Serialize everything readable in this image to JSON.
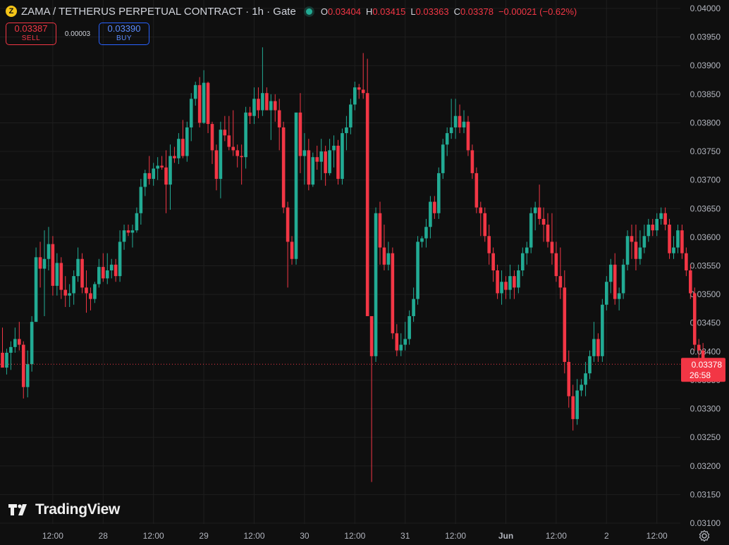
{
  "header": {
    "coin_glyph": "Z",
    "title": "ZAMA / TETHERUS PERPETUAL CONTRACT · 1h · Gate",
    "ohlc": {
      "o_label": "O",
      "o": "0.03404",
      "h_label": "H",
      "h": "0.03415",
      "l_label": "L",
      "l": "0.03363",
      "c_label": "C",
      "c": "0.03378",
      "change": "−0.00021 (−0.62%)"
    }
  },
  "trade": {
    "sell_price": "0.03387",
    "sell_label": "SELL",
    "spread": "0.00003",
    "buy_price": "0.03390",
    "buy_label": "BUY"
  },
  "price_tag": {
    "price": "0.03378",
    "countdown": "26:58"
  },
  "branding": {
    "logo_text": "TradingView"
  },
  "colors": {
    "background": "#0f0f0f",
    "grid": "#1e1e1e",
    "up": "#22ab94",
    "down": "#f23645",
    "axis_text": "#b2b5be",
    "buy_accent": "#2962ff"
  },
  "chart_data": {
    "type": "candlestick",
    "interval": "1h",
    "ylim": [
      0.031,
      0.04
    ],
    "y_ticks": [
      "0.03100",
      "0.03150",
      "0.03200",
      "0.03250",
      "0.03300",
      "0.03350",
      "0.03400",
      "0.03450",
      "0.03500",
      "0.03550",
      "0.03600",
      "0.03650",
      "0.03700",
      "0.03750",
      "0.03800",
      "0.03850",
      "0.03900",
      "0.03950",
      "0.04000"
    ],
    "x_ticks": [
      {
        "label": "12:00",
        "index": 12
      },
      {
        "label": "28",
        "index": 24
      },
      {
        "label": "12:00",
        "index": 36
      },
      {
        "label": "29",
        "index": 48
      },
      {
        "label": "12:00",
        "index": 60
      },
      {
        "label": "30",
        "index": 72
      },
      {
        "label": "12:00",
        "index": 84
      },
      {
        "label": "31",
        "index": 96
      },
      {
        "label": "12:00",
        "index": 108
      },
      {
        "label": "Jun",
        "index": 120
      },
      {
        "label": "12:00",
        "index": 132
      },
      {
        "label": "2",
        "index": 144
      },
      {
        "label": "12:00",
        "index": 156
      }
    ],
    "current_price": 0.03378,
    "candles": [
      [
        0.03398,
        0.03442,
        0.03378,
        0.03372
      ],
      [
        0.03372,
        0.03405,
        0.0336,
        0.03398
      ],
      [
        0.03398,
        0.03418,
        0.03368,
        0.03408
      ],
      [
        0.03408,
        0.03442,
        0.03398,
        0.03422
      ],
      [
        0.03422,
        0.03452,
        0.03402,
        0.03412
      ],
      [
        0.03412,
        0.03418,
        0.03318,
        0.03338
      ],
      [
        0.03338,
        0.03402,
        0.0332,
        0.03378
      ],
      [
        0.03378,
        0.03462,
        0.03365,
        0.03452
      ],
      [
        0.03452,
        0.03582,
        0.03452,
        0.03565
      ],
      [
        0.03565,
        0.03592,
        0.03512,
        0.03545
      ],
      [
        0.03545,
        0.03612,
        0.03462,
        0.03562
      ],
      [
        0.03562,
        0.03618,
        0.03542,
        0.03588
      ],
      [
        0.03588,
        0.03602,
        0.03498,
        0.03515
      ],
      [
        0.03515,
        0.03572,
        0.03498,
        0.03555
      ],
      [
        0.03555,
        0.03565,
        0.03492,
        0.03508
      ],
      [
        0.03508,
        0.03532,
        0.03478,
        0.03498
      ],
      [
        0.03498,
        0.03518,
        0.03478,
        0.03502
      ],
      [
        0.03502,
        0.03542,
        0.03482,
        0.03532
      ],
      [
        0.03532,
        0.03582,
        0.03522,
        0.03562
      ],
      [
        0.03562,
        0.03572,
        0.03502,
        0.03512
      ],
      [
        0.03512,
        0.03542,
        0.03468,
        0.03502
      ],
      [
        0.03502,
        0.03512,
        0.03472,
        0.03492
      ],
      [
        0.03492,
        0.03522,
        0.03485,
        0.03518
      ],
      [
        0.03518,
        0.03562,
        0.03512,
        0.03548
      ],
      [
        0.03548,
        0.03572,
        0.03522,
        0.03528
      ],
      [
        0.03528,
        0.03572,
        0.03518,
        0.03542
      ],
      [
        0.03542,
        0.03562,
        0.03528,
        0.03552
      ],
      [
        0.03552,
        0.03562,
        0.03522,
        0.03532
      ],
      [
        0.03532,
        0.03612,
        0.03522,
        0.03592
      ],
      [
        0.03592,
        0.03622,
        0.03578,
        0.03612
      ],
      [
        0.03612,
        0.03622,
        0.03602,
        0.03608
      ],
      [
        0.03608,
        0.03622,
        0.03582,
        0.03612
      ],
      [
        0.03612,
        0.03652,
        0.03608,
        0.03642
      ],
      [
        0.03642,
        0.03702,
        0.03622,
        0.03688
      ],
      [
        0.03688,
        0.03718,
        0.03672,
        0.03712
      ],
      [
        0.03712,
        0.03742,
        0.03692,
        0.03702
      ],
      [
        0.03702,
        0.0373,
        0.0369,
        0.0372
      ],
      [
        0.0372,
        0.0374,
        0.037,
        0.03725
      ],
      [
        0.03725,
        0.03742,
        0.03718,
        0.03722
      ],
      [
        0.03722,
        0.03752,
        0.03642,
        0.03692
      ],
      [
        0.03692,
        0.03762,
        0.03648,
        0.03742
      ],
      [
        0.03742,
        0.03758,
        0.0373,
        0.03738
      ],
      [
        0.03738,
        0.03782,
        0.03728,
        0.03772
      ],
      [
        0.03772,
        0.03805,
        0.03738,
        0.03742
      ],
      [
        0.03742,
        0.03802,
        0.03732,
        0.03792
      ],
      [
        0.03792,
        0.03852,
        0.03768,
        0.03842
      ],
      [
        0.03842,
        0.03872,
        0.0383,
        0.03866
      ],
      [
        0.03866,
        0.0388,
        0.03792,
        0.038
      ],
      [
        0.038,
        0.03892,
        0.03798,
        0.0387
      ],
      [
        0.0387,
        0.03872,
        0.03782,
        0.03798
      ],
      [
        0.03798,
        0.03802,
        0.03728,
        0.03752
      ],
      [
        0.03752,
        0.03762,
        0.03682,
        0.03702
      ],
      [
        0.03702,
        0.03802,
        0.03668,
        0.03788
      ],
      [
        0.03788,
        0.03812,
        0.03768,
        0.03778
      ],
      [
        0.03778,
        0.03812,
        0.03752,
        0.03758
      ],
      [
        0.03758,
        0.03822,
        0.03742,
        0.03752
      ],
      [
        0.03752,
        0.03762,
        0.03722,
        0.03742
      ],
      [
        0.03742,
        0.03762,
        0.03692,
        0.0374
      ],
      [
        0.0374,
        0.03828,
        0.0372,
        0.03818
      ],
      [
        0.03818,
        0.03828,
        0.03798,
        0.03812
      ],
      [
        0.03812,
        0.03862,
        0.03798,
        0.03842
      ],
      [
        0.03842,
        0.03862,
        0.03808,
        0.03822
      ],
      [
        0.03822,
        0.03932,
        0.03812,
        0.03852
      ],
      [
        0.03852,
        0.03862,
        0.03832,
        0.03822
      ],
      [
        0.03822,
        0.0385,
        0.0377,
        0.03838
      ],
      [
        0.03838,
        0.0385,
        0.03802,
        0.03822
      ],
      [
        0.03822,
        0.03842,
        0.03752,
        0.03792
      ],
      [
        0.03792,
        0.03802,
        0.03642,
        0.03652
      ],
      [
        0.03652,
        0.03662,
        0.03512,
        0.03592
      ],
      [
        0.03592,
        0.03602,
        0.03552,
        0.03562
      ],
      [
        0.03562,
        0.03812,
        0.03552,
        0.03818
      ],
      [
        0.03818,
        0.03852,
        0.03712,
        0.03742
      ],
      [
        0.03742,
        0.03782,
        0.03692,
        0.03752
      ],
      [
        0.03752,
        0.03772,
        0.03682,
        0.03692
      ],
      [
        0.03692,
        0.03748,
        0.03688,
        0.0374
      ],
      [
        0.0374,
        0.0376,
        0.03718,
        0.03732
      ],
      [
        0.03732,
        0.03772,
        0.037,
        0.0375
      ],
      [
        0.0375,
        0.0376,
        0.0369,
        0.03712
      ],
      [
        0.03712,
        0.03772,
        0.03708,
        0.03752
      ],
      [
        0.03752,
        0.03778,
        0.03722,
        0.0376
      ],
      [
        0.0376,
        0.0377,
        0.03692,
        0.03702
      ],
      [
        0.03702,
        0.0379,
        0.03692,
        0.03782
      ],
      [
        0.03782,
        0.03812,
        0.03752,
        0.03792
      ],
      [
        0.03792,
        0.03842,
        0.0378,
        0.03832
      ],
      [
        0.03832,
        0.03872,
        0.03822,
        0.03862
      ],
      [
        0.03862,
        0.03868,
        0.03842,
        0.03858
      ],
      [
        0.03858,
        0.03922,
        0.03842,
        0.03852
      ],
      [
        0.03852,
        0.03912,
        0.03542,
        0.03462
      ],
      [
        0.03462,
        0.03462,
        0.03172,
        0.03392
      ],
      [
        0.03392,
        0.03652,
        0.03382,
        0.03642
      ],
      [
        0.03642,
        0.03662,
        0.03552,
        0.03582
      ],
      [
        0.03582,
        0.03622,
        0.03542,
        0.03552
      ],
      [
        0.03552,
        0.03592,
        0.03542,
        0.03572
      ],
      [
        0.03572,
        0.03582,
        0.03422,
        0.03432
      ],
      [
        0.03432,
        0.03448,
        0.03392,
        0.03402
      ],
      [
        0.03402,
        0.03432,
        0.03392,
        0.03412
      ],
      [
        0.03412,
        0.03452,
        0.03402,
        0.03422
      ],
      [
        0.03422,
        0.03472,
        0.03412,
        0.03462
      ],
      [
        0.03462,
        0.03512,
        0.03452,
        0.03492
      ],
      [
        0.03492,
        0.03602,
        0.03482,
        0.03592
      ],
      [
        0.03592,
        0.03602,
        0.03582,
        0.03598
      ],
      [
        0.03598,
        0.03632,
        0.03582,
        0.03618
      ],
      [
        0.03618,
        0.03672,
        0.03598,
        0.03662
      ],
      [
        0.03662,
        0.03672,
        0.03632,
        0.03642
      ],
      [
        0.03642,
        0.03722,
        0.03632,
        0.03712
      ],
      [
        0.03712,
        0.03772,
        0.03702,
        0.03762
      ],
      [
        0.03762,
        0.03792,
        0.03742,
        0.03782
      ],
      [
        0.03782,
        0.03842,
        0.03772,
        0.03792
      ],
      [
        0.03792,
        0.03842,
        0.03772,
        0.03812
      ],
      [
        0.03812,
        0.03832,
        0.03782,
        0.03792
      ],
      [
        0.03792,
        0.03822,
        0.03782,
        0.03802
      ],
      [
        0.03802,
        0.03812,
        0.03742,
        0.03752
      ],
      [
        0.03752,
        0.03762,
        0.03702,
        0.03712
      ],
      [
        0.03712,
        0.03722,
        0.03642,
        0.03652
      ],
      [
        0.03652,
        0.03662,
        0.03602,
        0.03642
      ],
      [
        0.03642,
        0.03652,
        0.03592,
        0.03602
      ],
      [
        0.03602,
        0.03622,
        0.03552,
        0.03572
      ],
      [
        0.03572,
        0.03582,
        0.03522,
        0.03542
      ],
      [
        0.03542,
        0.03552,
        0.03492,
        0.03502
      ],
      [
        0.03502,
        0.03542,
        0.03482,
        0.03522
      ],
      [
        0.03522,
        0.03532,
        0.03492,
        0.03508
      ],
      [
        0.03508,
        0.03552,
        0.03492,
        0.03532
      ],
      [
        0.03532,
        0.03542,
        0.03492,
        0.03512
      ],
      [
        0.03512,
        0.03552,
        0.03502,
        0.03542
      ],
      [
        0.03542,
        0.03582,
        0.03532,
        0.03572
      ],
      [
        0.03572,
        0.03592,
        0.03552,
        0.03582
      ],
      [
        0.03582,
        0.03652,
        0.03572,
        0.03642
      ],
      [
        0.03642,
        0.03662,
        0.03612,
        0.03652
      ],
      [
        0.03652,
        0.03692,
        0.03622,
        0.03632
      ],
      [
        0.03632,
        0.03652,
        0.03592,
        0.03622
      ],
      [
        0.03622,
        0.03642,
        0.03582,
        0.03592
      ],
      [
        0.03592,
        0.03642,
        0.03552,
        0.03572
      ],
      [
        0.03572,
        0.03592,
        0.03522,
        0.03532
      ],
      [
        0.03532,
        0.03582,
        0.03492,
        0.03512
      ],
      [
        0.03512,
        0.03542,
        0.03362,
        0.03382
      ],
      [
        0.03382,
        0.03402,
        0.03302,
        0.03322
      ],
      [
        0.03322,
        0.03342,
        0.03262,
        0.03282
      ],
      [
        0.03282,
        0.03352,
        0.03272,
        0.03332
      ],
      [
        0.03332,
        0.03352,
        0.03322,
        0.03342
      ],
      [
        0.03342,
        0.03382,
        0.03322,
        0.03362
      ],
      [
        0.03362,
        0.03402,
        0.03352,
        0.03392
      ],
      [
        0.03392,
        0.03452,
        0.03382,
        0.03422
      ],
      [
        0.03422,
        0.03432,
        0.03382,
        0.03392
      ],
      [
        0.03392,
        0.03492,
        0.03382,
        0.03482
      ],
      [
        0.03482,
        0.03532,
        0.03472,
        0.03522
      ],
      [
        0.03522,
        0.03562,
        0.03502,
        0.03552
      ],
      [
        0.03552,
        0.03572,
        0.03482,
        0.03492
      ],
      [
        0.03492,
        0.03512,
        0.03472,
        0.03502
      ],
      [
        0.03502,
        0.03562,
        0.03492,
        0.03552
      ],
      [
        0.03552,
        0.03612,
        0.03542,
        0.03602
      ],
      [
        0.03602,
        0.03622,
        0.03562,
        0.03592
      ],
      [
        0.03592,
        0.03622,
        0.03542,
        0.03562
      ],
      [
        0.03562,
        0.03612,
        0.03552,
        0.03582
      ],
      [
        0.03582,
        0.03622,
        0.03572,
        0.03602
      ],
      [
        0.03602,
        0.03632,
        0.03592,
        0.03622
      ],
      [
        0.03622,
        0.03632,
        0.03602,
        0.03612
      ],
      [
        0.03612,
        0.03642,
        0.03602,
        0.03632
      ],
      [
        0.03632,
        0.03652,
        0.03622,
        0.03642
      ],
      [
        0.03642,
        0.03652,
        0.03612,
        0.03622
      ],
      [
        0.03622,
        0.03632,
        0.03562,
        0.03572
      ],
      [
        0.03572,
        0.03602,
        0.03562,
        0.03582
      ],
      [
        0.03582,
        0.03622,
        0.03572,
        0.03612
      ],
      [
        0.03612,
        0.03622,
        0.03562,
        0.03572
      ],
      [
        0.03572,
        0.03582,
        0.03532,
        0.03542
      ],
      [
        0.03542,
        0.03552,
        0.03492,
        0.03502
      ],
      [
        0.03502,
        0.03512,
        0.03402,
        0.03412
      ],
      [
        0.03412,
        0.03422,
        0.03382,
        0.03402
      ],
      [
        0.03402,
        0.03415,
        0.03363,
        0.03378
      ]
    ]
  }
}
